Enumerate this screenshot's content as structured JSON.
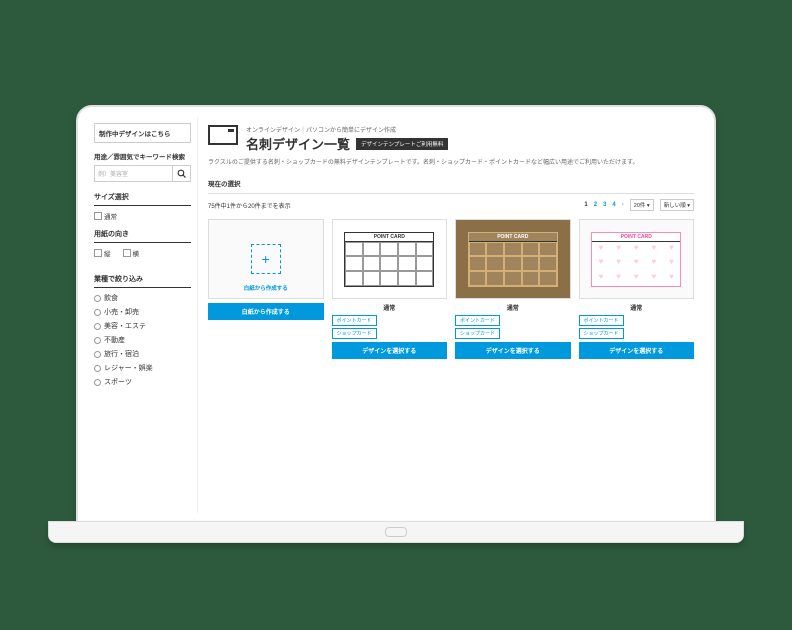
{
  "sidebar": {
    "wip_link": "制作中デザインはこちら",
    "search_label": "用途／雰囲気でキーワード検索",
    "search_placeholder": "例）美容室",
    "size_h": "サイズ選択",
    "size_opt": "通常",
    "orient_h": "用紙の向き",
    "orient_v": "縦",
    "orient_hh": "横",
    "cat_h": "業種で絞り込み",
    "cats": [
      "飲食",
      "小売・卸売",
      "美容・エステ",
      "不動産",
      "旅行・宿泊",
      "レジャー・娯楽",
      "スポーツ"
    ]
  },
  "header": {
    "breadcrumb": "オンラインデザイン｜パソコンから簡単にデザイン作成",
    "title": "名刺デザイン一覧",
    "badge": "デザインテンプレートご利用無料",
    "desc": "ラクスルのご提供する名刺・ショップカードの無料デザインテンプレートです。名刺・ショップカード・ポイントカードなど幅広い用途でご利用いただけます。"
  },
  "listing": {
    "cur_sel": "現在の選択",
    "count": "75件中1件から20件までを表示",
    "pages": [
      "1",
      "2",
      "3",
      "4"
    ],
    "per_page": "20件",
    "sort": "新しい順"
  },
  "cards": {
    "create_label": "白紙から作成する",
    "create_btn": "白紙から作成する",
    "pc_title": "POINT CARD",
    "type_label": "通常",
    "tag1": "ポイントカード",
    "tag2": "ショップカード",
    "select_btn": "デザインを選択する"
  }
}
